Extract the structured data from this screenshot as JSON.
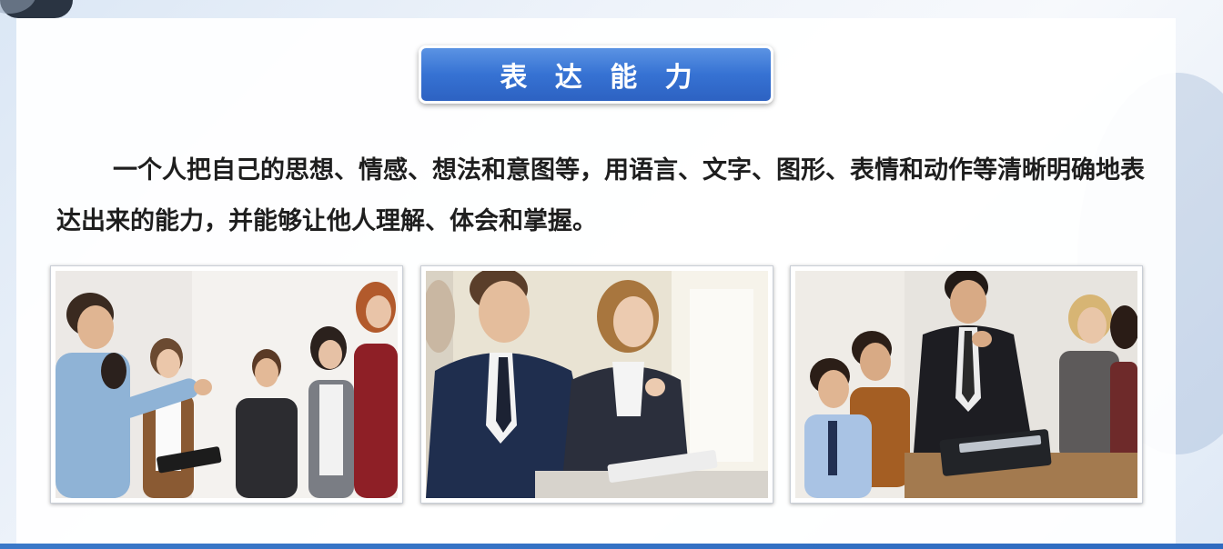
{
  "slide": {
    "title": "表 达 能 力",
    "paragraph_line1": "一个人把自己的思想、情感、想法和意图等，用语言、文字、图形、表情和动作等",
    "paragraph_line2": "清晰明确地表达出来的能力，并能够让他人理解、体会和掌握。"
  },
  "photos": [
    {
      "icon": "group-discussion-photo"
    },
    {
      "icon": "business-meeting-photo"
    },
    {
      "icon": "office-team-photo"
    }
  ],
  "colors": {
    "title_badge": "#3672d3",
    "accent_bar": "#3a78c8",
    "text": "#1e1e1e"
  }
}
